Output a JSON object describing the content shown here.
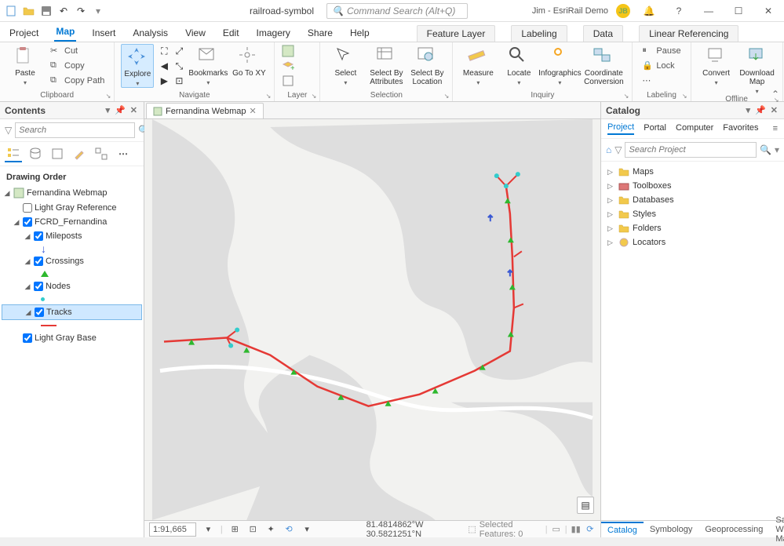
{
  "title": "railroad-symbol",
  "command_search_placeholder": "Command Search (Alt+Q)",
  "user": "Jim - EsriRail Demo",
  "user_initials": "JB",
  "ribbon_tabs": [
    "Project",
    "Map",
    "Insert",
    "Analysis",
    "View",
    "Edit",
    "Imagery",
    "Share",
    "Help"
  ],
  "context_tabs": [
    "Feature Layer",
    "Labeling",
    "Data",
    "Linear Referencing"
  ],
  "active_ribbon_tab": "Map",
  "ribbon": {
    "clipboard": {
      "label": "Clipboard",
      "paste": "Paste",
      "cut": "Cut",
      "copy": "Copy",
      "copy_path": "Copy Path"
    },
    "navigate": {
      "label": "Navigate",
      "explore": "Explore",
      "bookmarks": "Bookmarks",
      "goto": "Go To XY"
    },
    "layer": {
      "label": "Layer"
    },
    "selection": {
      "label": "Selection",
      "select": "Select",
      "by_attr": "Select By Attributes",
      "by_loc": "Select By Location"
    },
    "inquiry": {
      "label": "Inquiry",
      "measure": "Measure",
      "locate": "Locate",
      "info": "Infographics",
      "coord": "Coordinate Conversion"
    },
    "labeling": {
      "label": "Labeling",
      "pause": "Pause",
      "lock": "Lock"
    },
    "offline": {
      "label": "Offline",
      "convert": "Convert",
      "download": "Download Map"
    }
  },
  "contents": {
    "title": "Contents",
    "search_placeholder": "Search",
    "drawing_order": "Drawing Order",
    "map_name": "Fernandina Webmap",
    "layers": {
      "light_gray_ref": "Light Gray Reference",
      "fcrd": "FCRD_Fernandina",
      "mileposts": "Mileposts",
      "crossings": "Crossings",
      "nodes": "Nodes",
      "tracks": "Tracks",
      "light_gray_base": "Light Gray Base"
    }
  },
  "map": {
    "tab_name": "Fernandina Webmap",
    "scale": "1:91,665",
    "coords": "81.4814862°W 30.5821251°N",
    "selected_features": "Selected Features: 0"
  },
  "catalog": {
    "title": "Catalog",
    "subtabs": [
      "Project",
      "Portal",
      "Computer",
      "Favorites"
    ],
    "search_placeholder": "Search Project",
    "items": [
      "Maps",
      "Toolboxes",
      "Databases",
      "Styles",
      "Folders",
      "Locators"
    ],
    "bottom_tabs": [
      "Catalog",
      "Symbology",
      "Geoprocessing",
      "Save Web Map"
    ]
  }
}
